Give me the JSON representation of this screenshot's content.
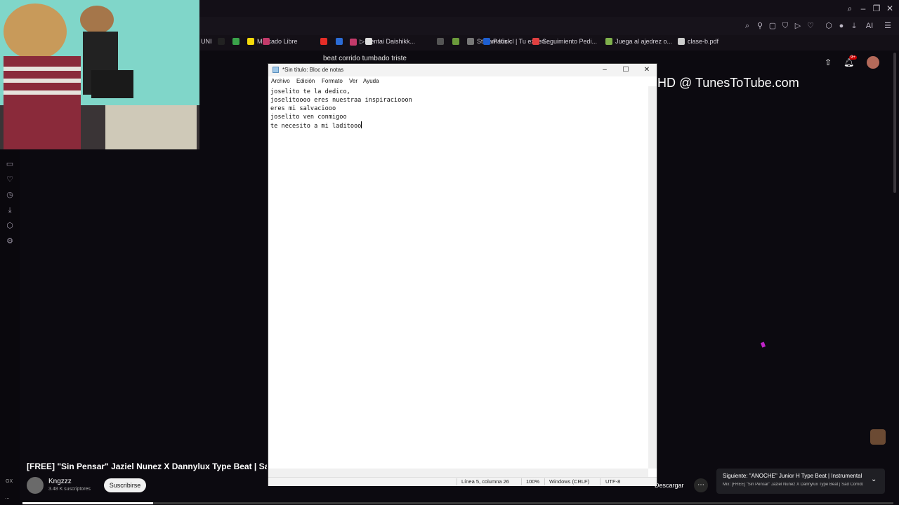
{
  "browser": {
    "search_query": "beat corrido tumbado triste",
    "ai_label": "AI"
  },
  "bookmarks": [
    {
      "label": "UNI",
      "color": "#444"
    },
    {
      "label": "",
      "color": "#222"
    },
    {
      "label": "",
      "color": "#3aa34a"
    },
    {
      "label": "Mercado Libre",
      "color": "#f5d90a"
    },
    {
      "label": "",
      "color": "#c33a6a"
    },
    {
      "label": "",
      "color": "#e52d27"
    },
    {
      "label": "",
      "color": "#2b6cd6"
    },
    {
      "label": "▷ Sentai Daishikk...",
      "color": "#c33a6a"
    },
    {
      "label": "",
      "color": "#ddd"
    },
    {
      "label": "",
      "color": "#555"
    },
    {
      "label": "",
      "color": "#6b9a3b"
    },
    {
      "label": "Stream Kick",
      "color": "#777"
    },
    {
      "label": "Paris.cl | Tu experi...",
      "color": "#1e5fd1"
    },
    {
      "label": "Seguimiento Pedi...",
      "color": "#e04040"
    },
    {
      "label": "Juega al ajedrez o...",
      "color": "#7fb04c"
    },
    {
      "label": "clase-b.pdf",
      "color": "#ccc"
    }
  ],
  "video": {
    "overlay_text": "HD @ TunesToTube.com",
    "title": "[FREE] \"Sin Pensar\" Jaziel Nunez X Dannylux Type Beat | Sad Corrido Tumbado Instrumental",
    "channel": "Kngzzz",
    "subscribers": "3.48 K suscriptores",
    "subscribe_label": "Suscribirse",
    "download_label": "Descargar",
    "progress": 0.15,
    "next_title": "Siguiente: \"ANOCHE\" Junior H Type Beat | Instrumental",
    "next_sub": "Mix: [FREE] \"Sin Pensar\" Jaziel Nunez X Dannylux Type Beat | Sad Corrido Tumbado",
    "bell_badge": "9+"
  },
  "notepad": {
    "title": "*Sin título: Bloc de notas",
    "menu": [
      "Archivo",
      "Edición",
      "Formato",
      "Ver",
      "Ayuda"
    ],
    "lines": [
      "joselito te la dedico,",
      "joselitoooo eres nuestraa inspiraciooon",
      "eres mi salvaciooo",
      "joselito ven conmigoo",
      "te necesito a mi laditooo"
    ],
    "status": {
      "position": "Línea 5, columna 26",
      "zoom": "100%",
      "line_ending": "Windows (CRLF)",
      "encoding": "UTF-8"
    }
  },
  "sidebar": {
    "gx": "GX",
    "more": "..."
  }
}
